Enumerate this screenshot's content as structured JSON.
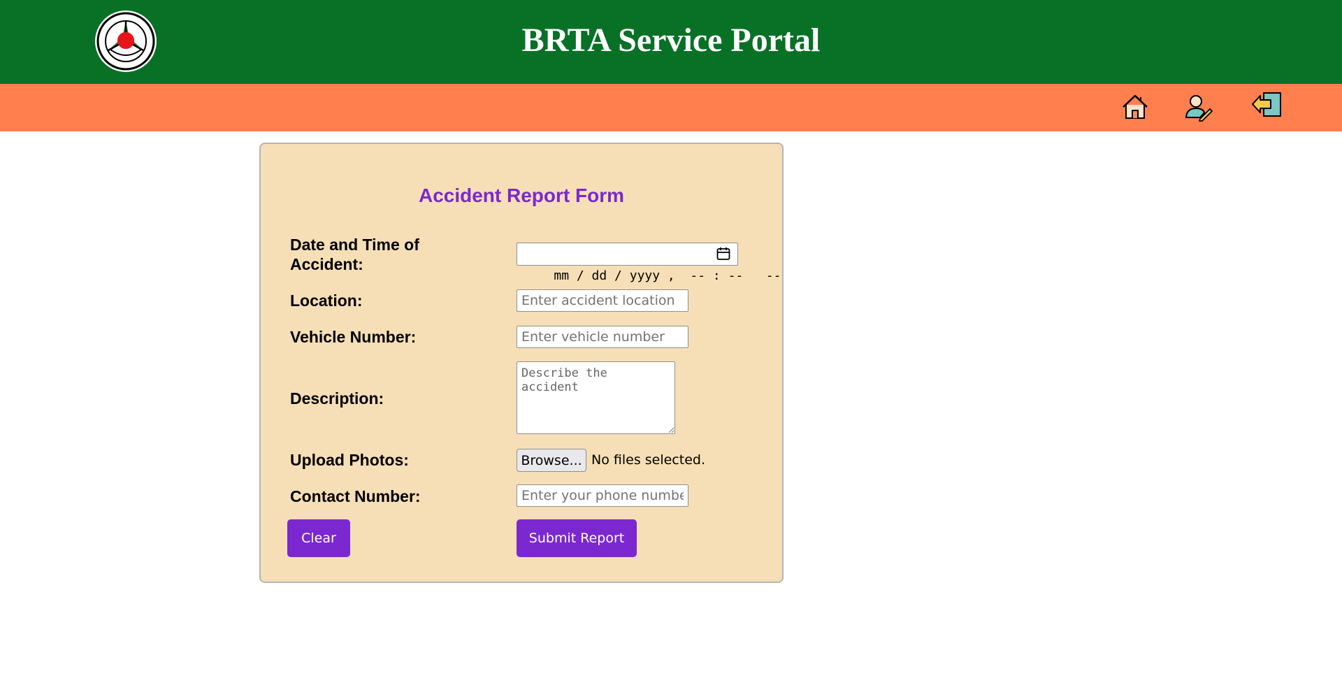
{
  "header": {
    "title": "BRTA Service Portal",
    "logo_icon": "brta-seal-icon",
    "bg_color": "#087126"
  },
  "navbar": {
    "bg_color": "#ff7f4f",
    "icons": [
      "home-icon",
      "profile-edit-icon",
      "logout-icon"
    ]
  },
  "form": {
    "title": "Accident Report Form",
    "bg_color": "#f6dfb6",
    "accent_color": "#7b28d0",
    "fields": {
      "datetime": {
        "label_line1": "Date and Time of",
        "label_line2": "Accident:",
        "display": "mm / dd / yyyy ,  -- : --   --"
      },
      "location": {
        "label": "Location:",
        "placeholder": "Enter accident location"
      },
      "vehicle": {
        "label": "Vehicle Number:",
        "placeholder": "Enter vehicle number"
      },
      "description": {
        "label": "Description:",
        "placeholder": "Describe the accident"
      },
      "photos": {
        "label": "Upload Photos:",
        "button": "Browse...",
        "status": "No files selected."
      },
      "contact": {
        "label": "Contact Number:",
        "placeholder": "Enter your phone number"
      }
    },
    "buttons": {
      "clear": "Clear",
      "submit": "Submit Report"
    }
  }
}
